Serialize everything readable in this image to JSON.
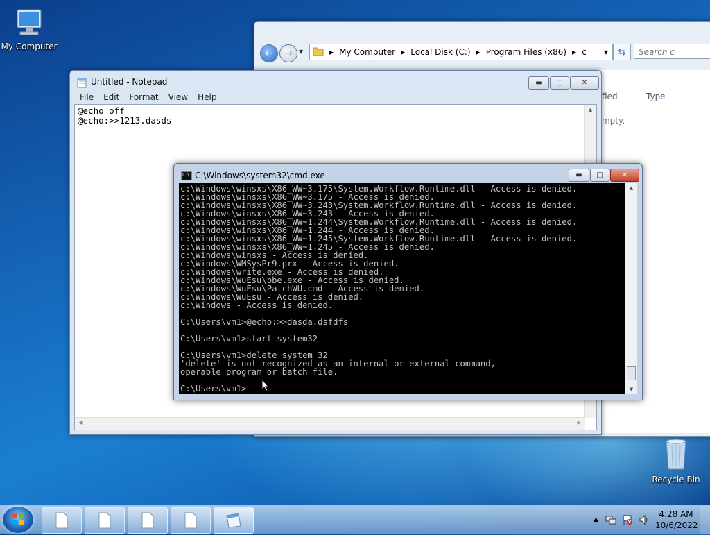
{
  "desktop": {
    "icons": [
      {
        "label": "My Computer"
      },
      {
        "label": "Recycle Bin"
      }
    ]
  },
  "explorer": {
    "breadcrumb": [
      "My Computer",
      "Local Disk (C:)",
      "Program Files (x86)",
      "c"
    ],
    "search_placeholder": "Search c",
    "columns": [
      "fied",
      "Type"
    ],
    "empty_text": "mpty."
  },
  "notepad": {
    "title": "Untitled - Notepad",
    "menu": [
      "File",
      "Edit",
      "Format",
      "View",
      "Help"
    ],
    "content": "@echo off\n@echo:>>1213.dasds"
  },
  "cmd": {
    "title": "C:\\Windows\\system32\\cmd.exe",
    "lines": [
      "c:\\Windows\\winsxs\\X86_WW~3.175\\System.Workflow.Runtime.dll - Access is denied.",
      "c:\\Windows\\winsxs\\X86_WW~3.175 - Access is denied.",
      "c:\\Windows\\winsxs\\X86_WW~3.243\\System.Workflow.Runtime.dll - Access is denied.",
      "c:\\Windows\\winsxs\\X86_WW~3.243 - Access is denied.",
      "c:\\Windows\\winsxs\\X86_WW~1.244\\System.Workflow.Runtime.dll - Access is denied.",
      "c:\\Windows\\winsxs\\X86_WW~1.244 - Access is denied.",
      "c:\\Windows\\winsxs\\X86_WW~1.245\\System.Workflow.Runtime.dll - Access is denied.",
      "c:\\Windows\\winsxs\\X86_WW~1.245 - Access is denied.",
      "c:\\Windows\\winsxs - Access is denied.",
      "c:\\Windows\\WMSysPr9.prx - Access is denied.",
      "c:\\Windows\\write.exe - Access is denied.",
      "c:\\Windows\\WuEsu\\bbe.exe - Access is denied.",
      "c:\\Windows\\WuEsu\\PatchWU.cmd - Access is denied.",
      "c:\\Windows\\WuEsu - Access is denied.",
      "c:\\Windows - Access is denied.",
      "",
      "C:\\Users\\vm1>@echo:>>dasda.dsfdfs",
      "",
      "C:\\Users\\vm1>start system32",
      "",
      "C:\\Users\\vm1>delete system 32",
      "'delete' is not recognized as an internal or external command,",
      "operable program or batch file.",
      "",
      "C:\\Users\\vm1>"
    ]
  },
  "taskbar": {
    "time": "4:28 AM",
    "date": "10/6/2022"
  }
}
